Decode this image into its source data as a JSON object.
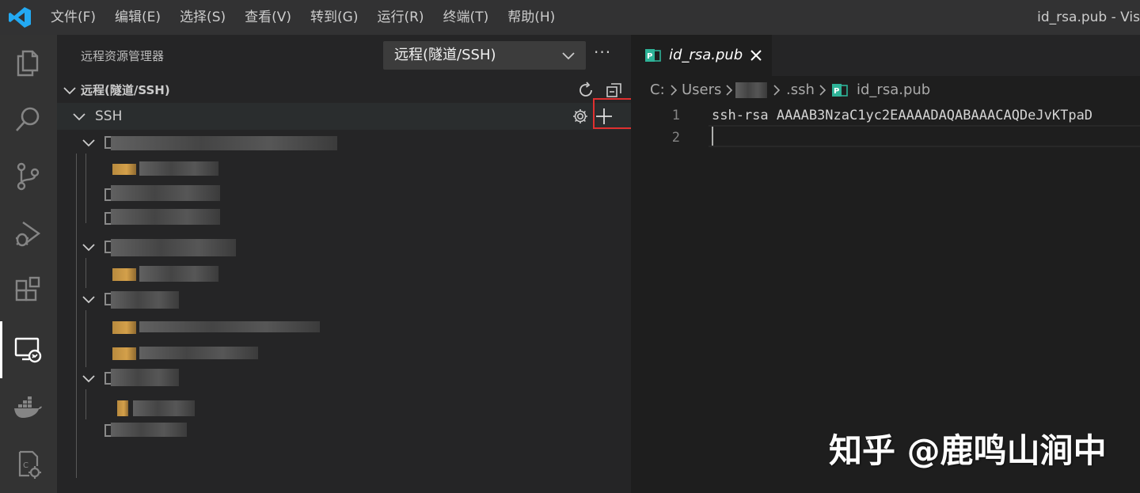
{
  "titlebar": {
    "menu": [
      "文件(F)",
      "编辑(E)",
      "选择(S)",
      "查看(V)",
      "转到(G)",
      "运行(R)",
      "终端(T)",
      "帮助(H)"
    ],
    "window_title": "id_rsa.pub - Vis"
  },
  "activitybar": {
    "icons": [
      "explorer-icon",
      "search-icon",
      "source-control-icon",
      "run-debug-icon",
      "extensions-icon",
      "remote-explorer-icon",
      "docker-icon",
      "settings-sync-icon"
    ],
    "active": "remote-explorer-icon"
  },
  "sidebar": {
    "title": "远程资源管理器",
    "remote_select": "远程(隧道/SSH)",
    "more": "···",
    "section_label": "远程(隧道/SSH)",
    "ssh_label": "SSH"
  },
  "editor": {
    "tab_label": "id_rsa.pub",
    "breadcrumb": {
      "drive": "C:",
      "users": "Users",
      "ssh": ".ssh",
      "file": "id_rsa.pub"
    },
    "lines": [
      {
        "num": "1",
        "text": "ssh-rsa AAAAB3NzaC1yc2EAAAADAQABAAACAQDeJvKTpaD"
      },
      {
        "num": "2",
        "text": ""
      }
    ]
  },
  "watermark": "知乎 @鹿鸣山涧中",
  "colors": {
    "accent": "#0098ff",
    "highlight_box": "#e03030",
    "file_icon": "#2eb398"
  }
}
